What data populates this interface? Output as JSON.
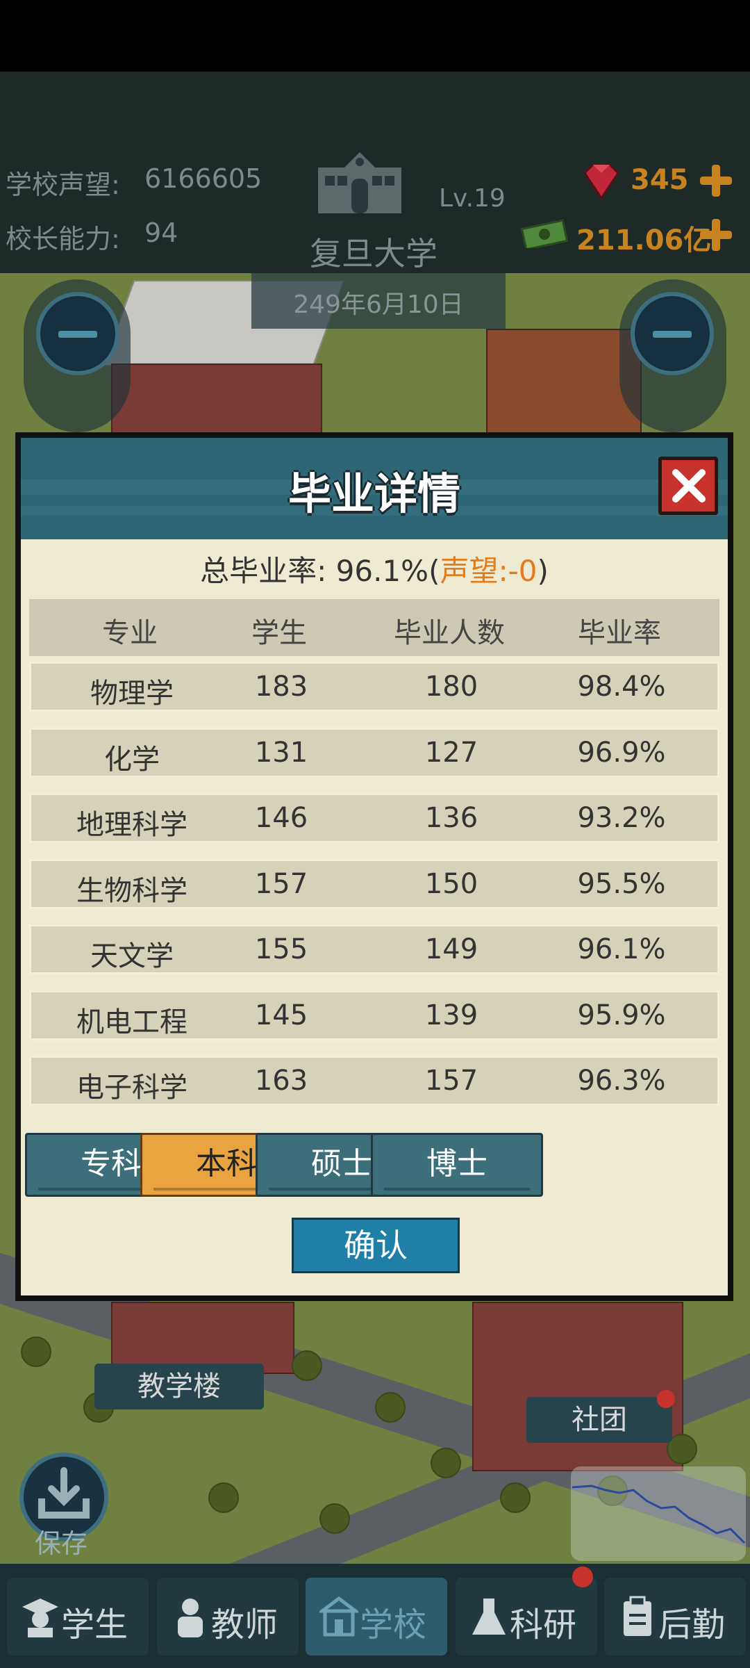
{
  "hud": {
    "prestige_label": "学校声望:",
    "prestige_value": "6166605",
    "ability_label": "校长能力:",
    "ability_value": "94",
    "school_name": "复旦大学",
    "level": "Lv.19",
    "date": "249年6月10日",
    "gems": "345",
    "money": "211.06亿"
  },
  "modal": {
    "title": "毕业详情",
    "summary_prefix": "总毕业率:",
    "summary_rate": "96.1%",
    "summary_open": "(",
    "summary_prestige": "声望:-0",
    "summary_close": ")",
    "columns": [
      "专业",
      "学生",
      "毕业人数",
      "毕业率"
    ],
    "rows": [
      [
        "物理学",
        "183",
        "180",
        "98.4%"
      ],
      [
        "化学",
        "131",
        "127",
        "96.9%"
      ],
      [
        "地理科学",
        "146",
        "136",
        "93.2%"
      ],
      [
        "生物科学",
        "157",
        "150",
        "95.5%"
      ],
      [
        "天文学",
        "155",
        "149",
        "96.1%"
      ],
      [
        "机电工程",
        "145",
        "139",
        "95.9%"
      ],
      [
        "电子科学",
        "163",
        "157",
        "96.3%"
      ]
    ],
    "tabs": [
      "专科",
      "本科",
      "硕士",
      "博士"
    ],
    "active_tab": "本科",
    "confirm": "确认"
  },
  "scene": {
    "building_label": "教学楼",
    "club_label": "社团",
    "save_label": "保存"
  },
  "nav": [
    "学生",
    "教师",
    "学校",
    "科研",
    "后勤"
  ],
  "active_nav": "学校",
  "colors": {
    "header": "#2f6676",
    "tab": "#3c6f79",
    "tab_active": "#e9a43f",
    "accent_orange": "#e57c1c",
    "gold": "#c8821e",
    "close": "#c8322c"
  }
}
